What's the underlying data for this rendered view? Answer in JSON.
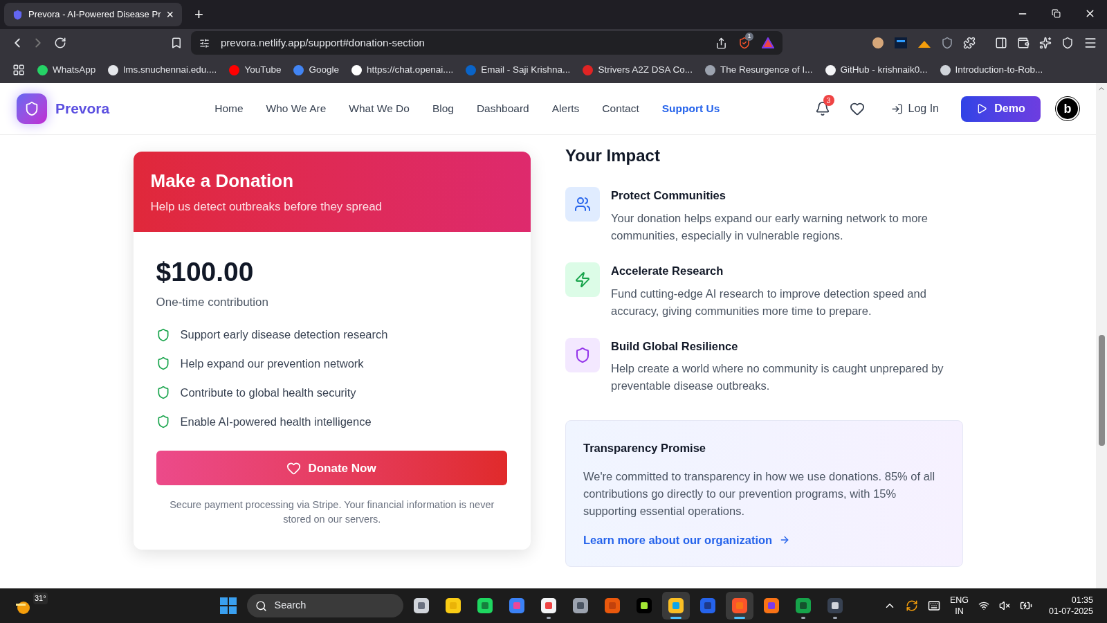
{
  "browser": {
    "tab": {
      "title": "Prevora - AI-Powered Disease Pr",
      "close": "×"
    },
    "new_tab": "+",
    "url": "prevora.netlify.app/support#donation-section",
    "shield_count": "1",
    "bookmarks": [
      {
        "label": "WhatsApp",
        "color": "#25d366"
      },
      {
        "label": "lms.snuchennai.edu....",
        "color": "#e5e7eb"
      },
      {
        "label": "YouTube",
        "color": "#ff0000"
      },
      {
        "label": "Google",
        "color": "#4285f4"
      },
      {
        "label": "https://chat.openai....",
        "color": "#ffffff"
      },
      {
        "label": "Email - Saji Krishna...",
        "color": "#0a64c8"
      },
      {
        "label": "Strivers A2Z DSA Co...",
        "color": "#e02424"
      },
      {
        "label": "The Resurgence of I...",
        "color": "#9ca3af"
      },
      {
        "label": "GitHub - krishnaik0...",
        "color": "#f3f4f6"
      },
      {
        "label": "Introduction-to-Rob...",
        "color": "#d1d5db"
      }
    ]
  },
  "navbar": {
    "brand": "Prevora",
    "links": [
      {
        "label": "Home",
        "selected": false
      },
      {
        "label": "Who We Are",
        "selected": false
      },
      {
        "label": "What We Do",
        "selected": false
      },
      {
        "label": "Blog",
        "selected": false
      },
      {
        "label": "Dashboard",
        "selected": false
      },
      {
        "label": "Alerts",
        "selected": false
      },
      {
        "label": "Contact",
        "selected": false
      },
      {
        "label": "Support Us",
        "selected": true
      }
    ],
    "notification_count": "3",
    "login": "Log In",
    "demo": "Demo",
    "avatar": "b"
  },
  "donation": {
    "title": "Make a Donation",
    "subtitle": "Help us detect outbreaks before they spread",
    "amount": "$100.00",
    "frequency": "One-time contribution",
    "benefits": [
      "Support early disease detection research",
      "Help expand our prevention network",
      "Contribute to global health security",
      "Enable AI-powered health intelligence"
    ],
    "button": "Donate Now",
    "note": "Secure payment processing via Stripe. Your financial information is never stored on our servers."
  },
  "impact": {
    "title": "Your Impact",
    "items": [
      {
        "kind": "people",
        "title": "Protect Communities",
        "text": "Your donation helps expand our early warning network to more communities, especially in vulnerable regions."
      },
      {
        "kind": "bolt",
        "title": "Accelerate Research",
        "text": "Fund cutting-edge AI research to improve detection speed and accuracy, giving communities more time to prepare."
      },
      {
        "kind": "shield",
        "title": "Build Global Resilience",
        "text": "Help create a world where no community is caught unprepared by preventable disease outbreaks."
      }
    ],
    "promise": {
      "title": "Transparency Promise",
      "text": "We're committed to transparency in how we use donations. 85% of all contributions go directly to our prevention programs, with 15% supporting essential operations.",
      "link": "Learn more about our organization"
    }
  },
  "taskbar": {
    "weather": "31°",
    "search_placeholder": "Search",
    "apps": [
      {
        "kind": "taskview",
        "open": false,
        "selected": false
      },
      {
        "kind": "sticky",
        "open": false,
        "selected": false
      },
      {
        "kind": "spotify",
        "open": false,
        "selected": false
      },
      {
        "kind": "copilot",
        "open": false,
        "selected": false
      },
      {
        "kind": "snip",
        "open": true,
        "selected": false
      },
      {
        "kind": "camera",
        "open": false,
        "selected": false
      },
      {
        "kind": "powerpoint",
        "open": false,
        "selected": false
      },
      {
        "kind": "pycharm",
        "open": false,
        "selected": false
      },
      {
        "kind": "explorer",
        "open": true,
        "selected": true
      },
      {
        "kind": "word",
        "open": false,
        "selected": false
      },
      {
        "kind": "brave",
        "open": true,
        "selected": true
      },
      {
        "kind": "firefox",
        "open": false,
        "selected": false
      },
      {
        "kind": "excel",
        "open": true,
        "selected": false
      },
      {
        "kind": "terminal",
        "open": true,
        "selected": false
      }
    ],
    "language": "ENG",
    "region": "IN",
    "time": "01:35",
    "date": "01-07-2025"
  }
}
